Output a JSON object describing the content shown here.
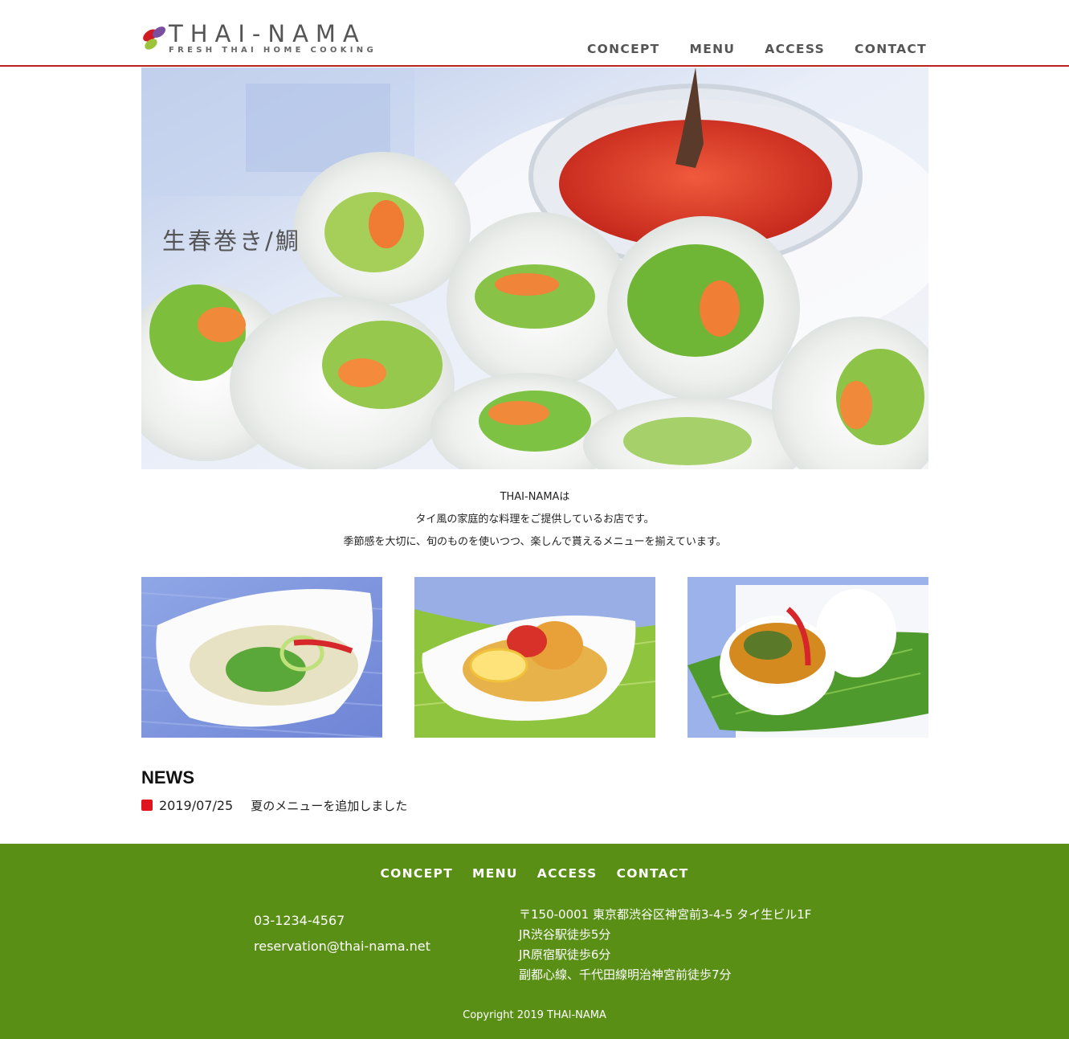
{
  "brand": {
    "title": "THAI-NAMA",
    "subtitle": "FRESH THAI HOME COOKING"
  },
  "nav": {
    "items": [
      "CONCEPT",
      "MENU",
      "ACCESS",
      "CONTACT"
    ]
  },
  "hero": {
    "caption": "生春巻き/鯛"
  },
  "intro": {
    "lines": [
      "THAI-NAMAは",
      "タイ風の家庭的な料理をご提供しているお店です。",
      "季節感を大切に、旬のものを使いつつ、楽しんで貰えるメニューを揃えています。"
    ]
  },
  "news": {
    "title": "NEWS",
    "items": [
      {
        "date": "2019/07/25",
        "text": "夏のメニューを追加しました"
      }
    ]
  },
  "footer": {
    "nav": [
      "CONCEPT",
      "MENU",
      "ACCESS",
      "CONTACT"
    ],
    "phone": "03-1234-4567",
    "email": "reservation@thai-nama.net",
    "address": [
      "〒150-0001 東京都渋谷区神宮前3-4-5 タイ生ビル1F",
      "JR渋谷駅徒歩5分",
      "JR原宿駅徒歩6分",
      "副都心線、千代田線明治神宮前徒歩7分"
    ],
    "copyright": "Copyright 2019 THAI-NAMA"
  },
  "colors": {
    "accent_line": "#b7231d",
    "footer_bg": "#5a8f15",
    "news_marker": "#e0141f"
  }
}
